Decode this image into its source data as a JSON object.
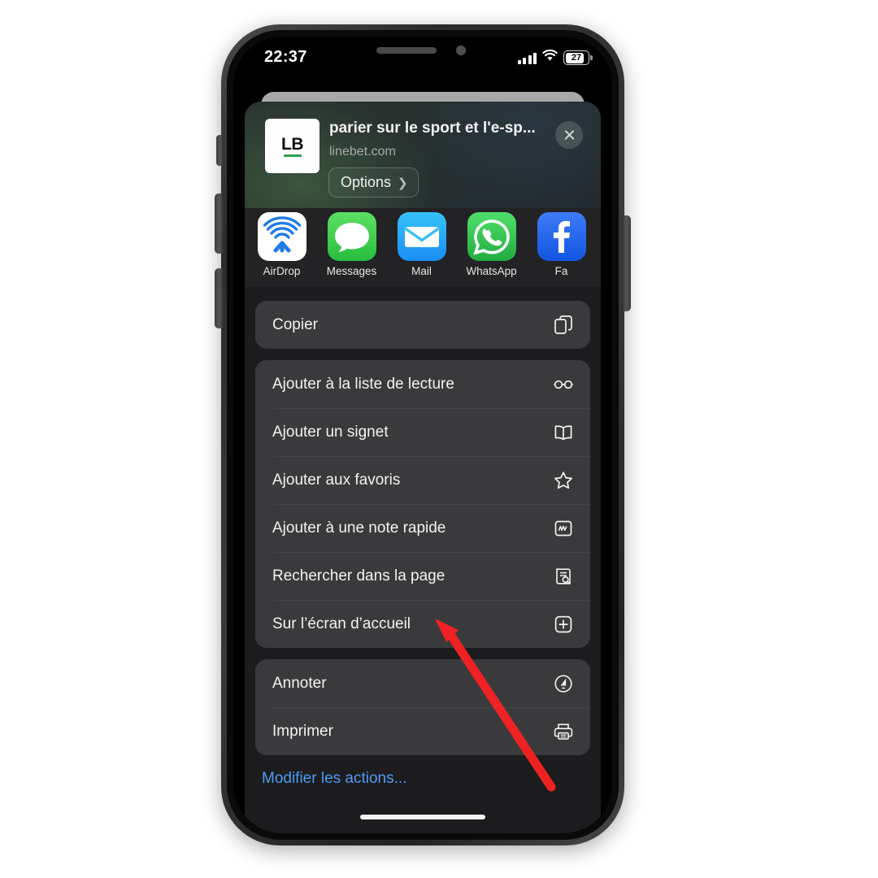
{
  "status_bar": {
    "time": "22:37",
    "signal_icon": "cellular-signal-icon",
    "wifi_icon": "wifi-icon",
    "battery_level": "27",
    "battery_icon": "battery-icon"
  },
  "share_sheet": {
    "header": {
      "thumbnail_text": "LB",
      "title": "parier sur le sport et l'e-sp...",
      "url": "linebet.com",
      "options_label": "Options",
      "options_chevron": "chevron-right-icon",
      "close_icon": "close-icon"
    },
    "apps": [
      {
        "label": "AirDrop",
        "icon": "airdrop-icon"
      },
      {
        "label": "Messages",
        "icon": "messages-icon"
      },
      {
        "label": "Mail",
        "icon": "mail-icon"
      },
      {
        "label": "WhatsApp",
        "icon": "whatsapp-icon"
      },
      {
        "label": "Fa",
        "icon": "facebook-icon"
      }
    ],
    "groups": [
      {
        "items": [
          {
            "label": "Copier",
            "icon": "copy-icon"
          }
        ]
      },
      {
        "items": [
          {
            "label": "Ajouter à la liste de lecture",
            "icon": "glasses-icon"
          },
          {
            "label": "Ajouter un signet",
            "icon": "book-icon"
          },
          {
            "label": "Ajouter aux favoris",
            "icon": "star-icon"
          },
          {
            "label": "Ajouter à une note rapide",
            "icon": "quick-note-icon"
          },
          {
            "label": "Rechercher dans la page",
            "icon": "find-in-page-icon"
          },
          {
            "label": "Sur l’écran d’accueil",
            "icon": "add-to-home-screen-icon"
          }
        ]
      },
      {
        "items": [
          {
            "label": "Annoter",
            "icon": "markup-pen-icon"
          },
          {
            "label": "Imprimer",
            "icon": "printer-icon"
          }
        ]
      }
    ],
    "edit_actions_label": "Modifier les actions...",
    "edit_actions_color": "#4f9bf5"
  },
  "annotation": {
    "arrow_color": "#ee2222",
    "target_label": "Sur l’écran d’accueil"
  }
}
